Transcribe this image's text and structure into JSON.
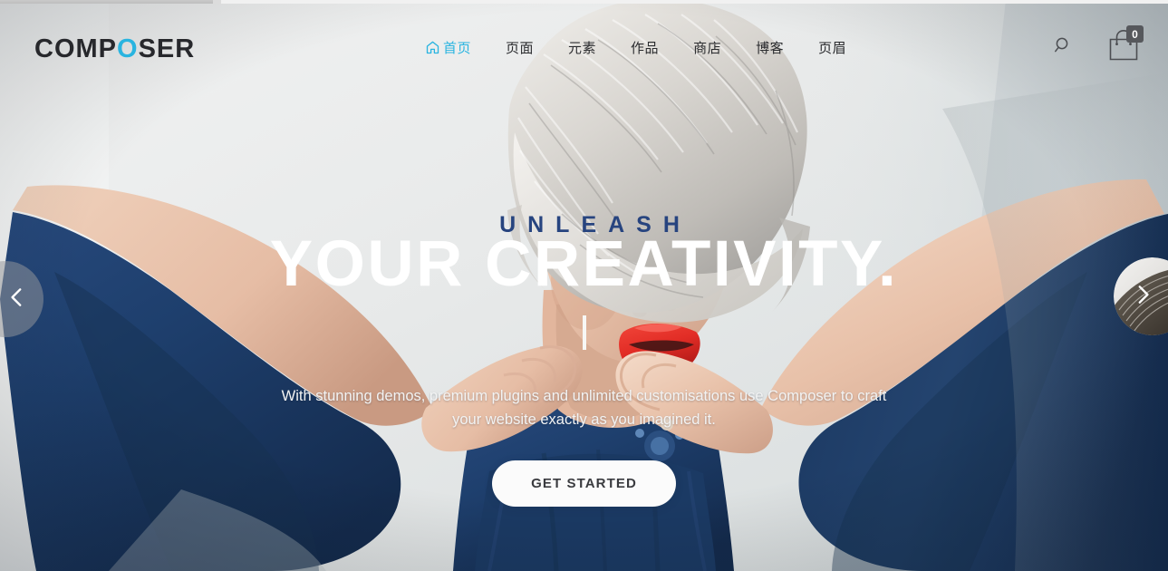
{
  "loader": {
    "progress_pct": 19
  },
  "brand": {
    "name": "COMPOSER",
    "name_part1": "COMP",
    "name_accent": "O",
    "name_part2": "SER",
    "accent_color": "#29b4e0"
  },
  "nav": {
    "items": [
      {
        "label": "首页",
        "icon": "home-icon",
        "active": true
      },
      {
        "label": "页面",
        "active": false
      },
      {
        "label": "元素",
        "active": false
      },
      {
        "label": "作品",
        "active": false
      },
      {
        "label": "商店",
        "active": false
      },
      {
        "label": "博客",
        "active": false
      },
      {
        "label": "页眉",
        "active": false
      }
    ]
  },
  "header_tools": {
    "search_icon": "search-icon",
    "cart_icon": "shopping-bag-icon",
    "cart_count": "0",
    "cart_badge_color": "#56585c"
  },
  "hero": {
    "eyebrow": "UNLEASH",
    "eyebrow_color": "#27447f",
    "title": "YOUR CREATIVITY.",
    "title_color": "#ffffff",
    "subtitle_line1": "With stunning demos, premium plugins and unlimited customisations use Composer to craft",
    "subtitle_line2": "your website exactly as you imagined it.",
    "cta_label": "GET STARTED",
    "divider": "vertical-rule"
  },
  "slider": {
    "prev_icon": "chevron-left-icon",
    "next_icon": "chevron-right-icon"
  },
  "palette": {
    "backdrop_light": "#e9ebeb",
    "navy_garment": "#1e3f6d",
    "lips_red": "#e22d26",
    "hair_platinum": "#d8d6d2",
    "skin": "#e9c4ae"
  }
}
